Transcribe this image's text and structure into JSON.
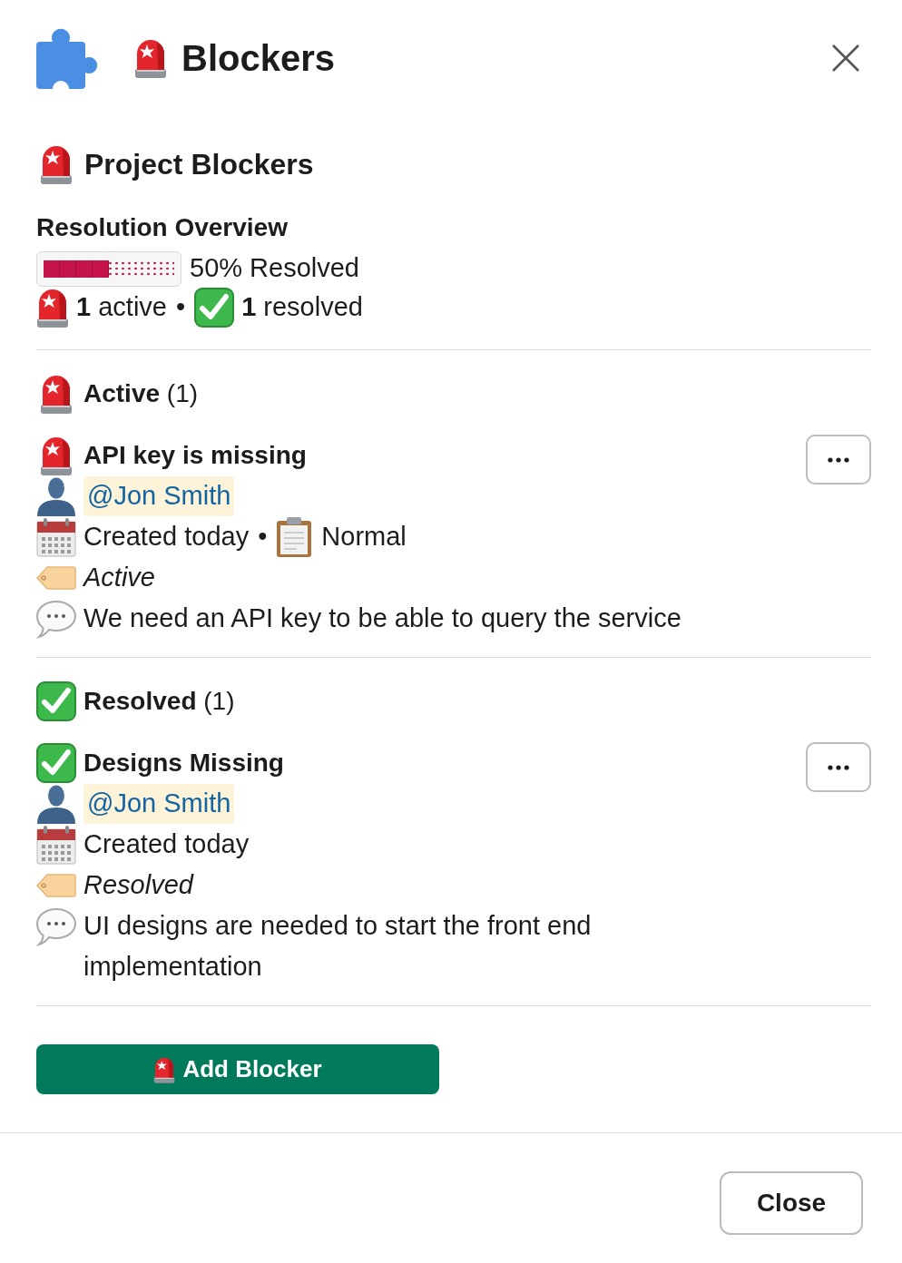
{
  "header": {
    "title": "Blockers"
  },
  "section": {
    "title": "Project Blockers"
  },
  "overview": {
    "heading": "Resolution Overview",
    "progress": {
      "level": 0.5,
      "reading": "50% Resolved"
    },
    "summary": [
      {
        "kind": "active",
        "text": "**1** active"
      },
      {
        "kind": "separator",
        "text": "•"
      },
      {
        "kind": "resolved",
        "text": "**1** resolved"
      }
    ]
  },
  "groups": [
    {
      "kind": "active",
      "heading": "**Active** (1)",
      "items": [
        {
          "kind": "active",
          "title": "API key is missing",
          "assignee": "@Jon Smith",
          "meta": [
            {
              "kind": "created",
              "text": "Created today"
            },
            {
              "kind": "separator",
              "text": "•"
            },
            {
              "kind": "priority",
              "text": "Normal"
            }
          ],
          "status": "Active",
          "description": "We need an API key to be able to query the service"
        }
      ]
    },
    {
      "kind": "resolved",
      "heading": "**Resolved** (1)",
      "items": [
        {
          "kind": "resolved",
          "title": "Designs Missing",
          "assignee": "@Jon Smith",
          "meta": [
            {
              "kind": "created",
              "text": "Created today"
            }
          ],
          "status": "Resolved",
          "description": "UI designs are needed to start the front end implementation"
        }
      ]
    }
  ],
  "add_button": {
    "label": "Add Blocker"
  },
  "footer": {
    "close_button": "Close"
  }
}
